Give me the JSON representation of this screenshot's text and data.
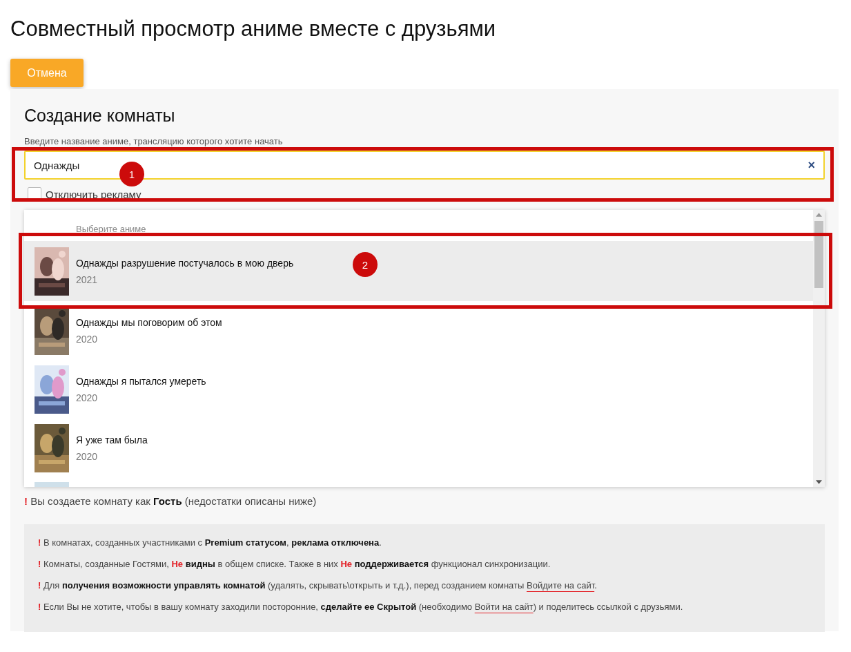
{
  "page_title": "Совместный просмотр аниме вместе с друзьями",
  "cancel_button": "Отмена",
  "panel": {
    "heading": "Создание комнаты",
    "hint": "Введите название аниме, трансляцию которого хотите начать",
    "search": {
      "value": "Однажды",
      "clear_icon": "×"
    },
    "disable_ads": {
      "label": "Отключить рекламу",
      "checked": false
    },
    "dropdown": {
      "header": "Выберите аниме",
      "more_below": true,
      "items": [
        {
          "title": "Однажды разрушение постучалось в мою дверь",
          "year": "2021",
          "selected": true,
          "kind": "picture"
        },
        {
          "title": "Однажды мы поговорим об этом",
          "year": "2020",
          "selected": false,
          "kind": "picture"
        },
        {
          "title": "Однажды я пытался умереть",
          "year": "2020",
          "selected": false,
          "kind": "picture"
        },
        {
          "title": "Я уже там была",
          "year": "2020",
          "selected": false,
          "kind": "picture"
        }
      ]
    },
    "guest_warning": [
      {
        "kind": "bang",
        "text": "!"
      },
      {
        "kind": "plain",
        "text": " Вы создаете комнату как "
      },
      {
        "kind": "bold",
        "text": "Гость"
      },
      {
        "kind": "plain",
        "text": " (недостатки описаны ниже)"
      }
    ],
    "notes": [
      [
        {
          "kind": "bang",
          "text": "!"
        },
        {
          "kind": "plain",
          "text": " В комнатах, созданных участниками с "
        },
        {
          "kind": "bold",
          "text": "Premium статусом"
        },
        {
          "kind": "plain",
          "text": ", "
        },
        {
          "kind": "bold",
          "text": "реклама отключена"
        },
        {
          "kind": "plain",
          "text": "."
        }
      ],
      [
        {
          "kind": "bang",
          "text": "!"
        },
        {
          "kind": "plain",
          "text": " Комнаты, созданные Гостями, "
        },
        {
          "kind": "warning",
          "text": "Не "
        },
        {
          "kind": "bold",
          "text": "видны"
        },
        {
          "kind": "plain",
          "text": " в общем списке. Также в них "
        },
        {
          "kind": "warning",
          "text": "Не "
        },
        {
          "kind": "bold",
          "text": "поддерживается"
        },
        {
          "kind": "plain",
          "text": " функционал синхронизации."
        }
      ],
      [
        {
          "kind": "bang",
          "text": "!"
        },
        {
          "kind": "plain",
          "text": " Для "
        },
        {
          "kind": "bold",
          "text": "получения возможности управлять комнатой"
        },
        {
          "kind": "plain",
          "text": " (удалять, скрывать\\открыть и т.д.), перед созданием комнаты "
        },
        {
          "kind": "link",
          "text": "Войдите на сайт"
        },
        {
          "kind": "plain",
          "text": "."
        }
      ],
      [
        {
          "kind": "bang",
          "text": "!"
        },
        {
          "kind": "plain",
          "text": " Если Вы не хотите, чтобы в вашу комнату заходили посторонние, "
        },
        {
          "kind": "bold",
          "text": "сделайте ее Скрытой"
        },
        {
          "kind": "plain",
          "text": " (необходимо "
        },
        {
          "kind": "link",
          "text": "Войти на сайт"
        },
        {
          "kind": "plain",
          "text": ") и поделитесь ссылкой с друзьями."
        }
      ]
    ]
  },
  "annotations": [
    {
      "label": "1"
    },
    {
      "label": "2"
    }
  ]
}
